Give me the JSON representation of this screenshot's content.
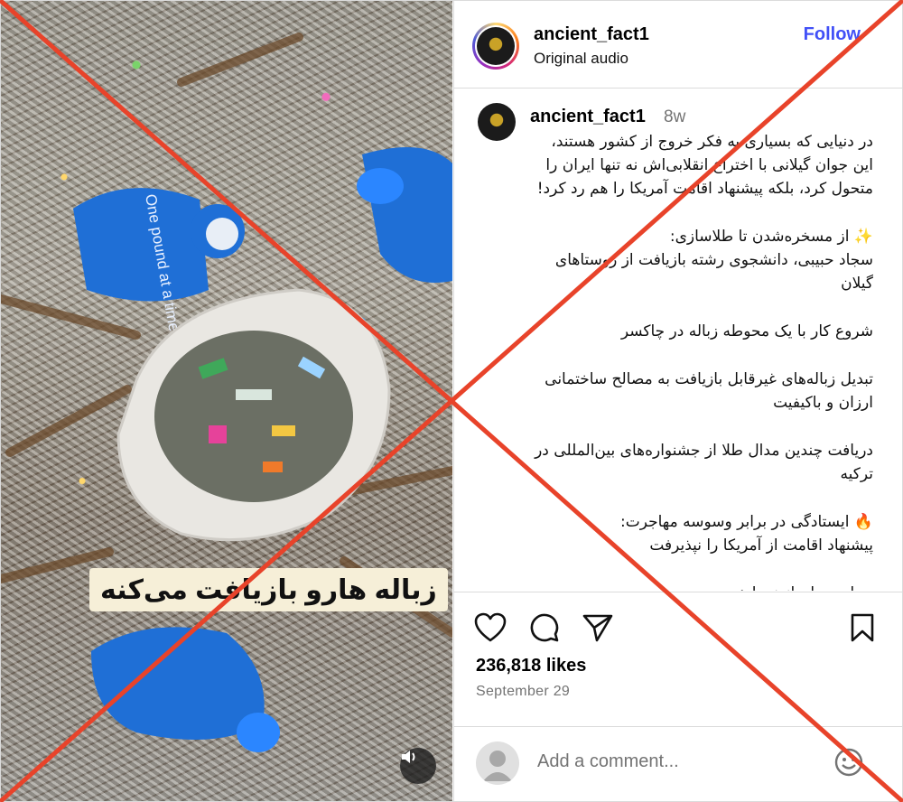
{
  "post": {
    "username": "ancient_fact1",
    "audio_label": "Original audio",
    "follow_label": "Follow",
    "age": "8w",
    "caption_paragraphs": [
      "در دنیایی که بسیاری به فکر خروج از کشور هستند، این جوان گیلانی با اختراع انقلابی‌اش نه تنها ایران را متحول کرد، بلکه پیشنهاد اقامت آمریکا را هم رد کرد!",
      "✨ از مسخره‌شدن تا طلاسازی:\nسجاد حبیبی، دانشجوی رشته بازیافت از روستاهای گیلان",
      "شروع کار با یک محوطه زباله در چاکسر",
      "تبدیل زباله‌های غیرقابل بازیافت به مصالح ساختمانی ارزان و باکیفیت",
      "دریافت چندین مدال طلا از جشنواره‌های بین‌المللی در ترکیه",
      "🔥 ایستادگی در برابر وسوسه مهاجرت:\nپیشنهاد اقامت از آمریکا را نپذیرفت",
      "جمله به یادماندنی او:"
    ],
    "likes": "236,818 likes",
    "date": "September 29",
    "comment_placeholder": "Add a comment..."
  },
  "media": {
    "overlay_caption": "زباله هارو بازیافت می‌کنه",
    "shirt_text": "One pound at a time."
  },
  "icons": {
    "like": "heart-icon",
    "comment": "comment-bubble-icon",
    "share": "paper-plane-icon",
    "save": "bookmark-icon",
    "emoji": "smiley-icon",
    "sound": "speaker-icon"
  },
  "colors": {
    "follow": "#4150f7",
    "cross": "#e8432a",
    "secondary_text": "#737373",
    "shirt_blue": "#1f6fd6"
  }
}
